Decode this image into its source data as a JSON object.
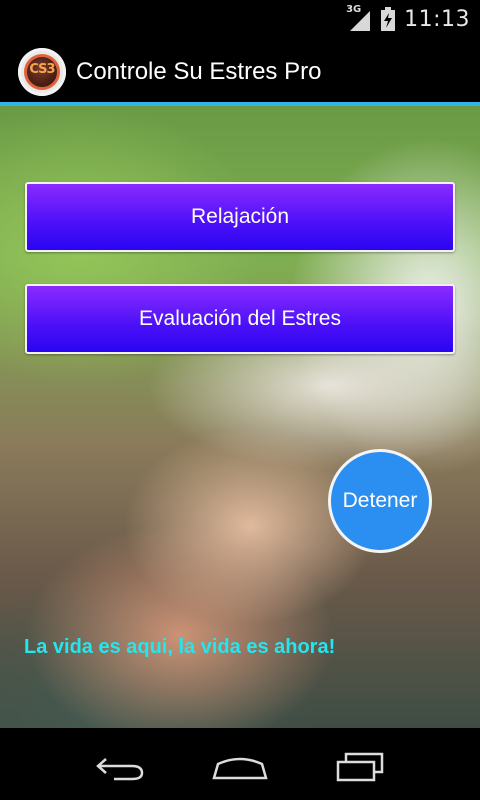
{
  "status_bar": {
    "network_label": "3G",
    "time": "11:13",
    "icons": [
      "signal-icon",
      "battery-icon"
    ]
  },
  "action_bar": {
    "app_icon_text": "CS3",
    "title": "Controle Su Estres Pro",
    "accent_color": "#33b5e5"
  },
  "main": {
    "buttons": {
      "relax_label": "Relajación",
      "evaluation_label": "Evaluación del Estres",
      "stop_label": "Detener"
    },
    "motto": "La vida es aqui, la vida es ahora!",
    "colors": {
      "button_top": "#8a2bff",
      "button_bottom": "#2a05f2",
      "stop_button": "#2a8ff0",
      "motto_text": "#22e6f0"
    }
  },
  "nav_bar": {
    "icons": [
      "back-icon",
      "home-icon",
      "recent-apps-icon"
    ]
  }
}
